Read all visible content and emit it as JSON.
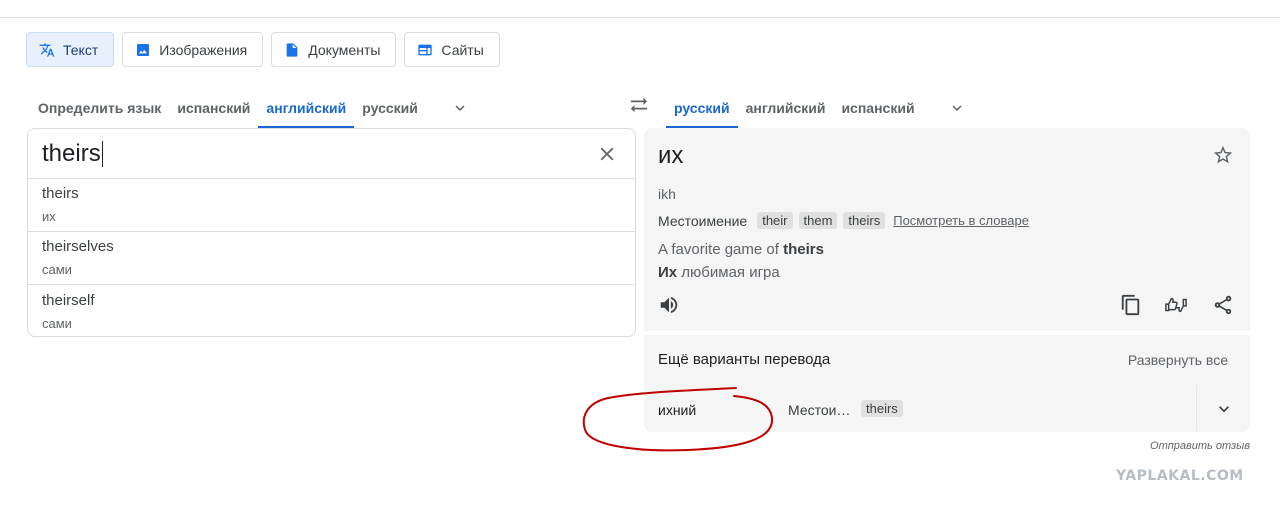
{
  "modes": [
    {
      "label": "Текст",
      "icon": "translate-icon",
      "active": true
    },
    {
      "label": "Изображения",
      "icon": "image-icon",
      "active": false
    },
    {
      "label": "Документы",
      "icon": "document-icon",
      "active": false
    },
    {
      "label": "Сайты",
      "icon": "website-icon",
      "active": false
    }
  ],
  "source_langs": {
    "detect": "Определить язык",
    "items": [
      "испанский",
      "английский",
      "русский"
    ],
    "active": "английский"
  },
  "target_langs": {
    "items": [
      "русский",
      "английский",
      "испанский"
    ],
    "active": "русский"
  },
  "source": {
    "text": "theirs",
    "suggestions": [
      {
        "word": "theirs",
        "translation": "их"
      },
      {
        "word": "theirselves",
        "translation": "сами"
      },
      {
        "word": "theirself",
        "translation": "сами"
      }
    ]
  },
  "target": {
    "text": "их",
    "transliteration": "ikh",
    "pos_label": "Местоимение",
    "chips": [
      "their",
      "them",
      "theirs"
    ],
    "dict_link": "Посмотреть в словаре",
    "example_src_pre": "A favorite game of ",
    "example_src_bold": "theirs",
    "example_tgt_bold": "Их",
    "example_tgt_post": " любимая игра"
  },
  "more": {
    "title": "Ещё варианты перевода",
    "expand_all": "Развернуть все",
    "variant": {
      "word": "ихний",
      "pos": "Местои…",
      "chip": "theirs"
    }
  },
  "feedback": "Отправить отзыв",
  "watermark": "YAPLAKAL.COM",
  "colors": {
    "accent": "#1967d2",
    "annotation": "#c00000",
    "panel_bg": "#f5f5f5"
  }
}
